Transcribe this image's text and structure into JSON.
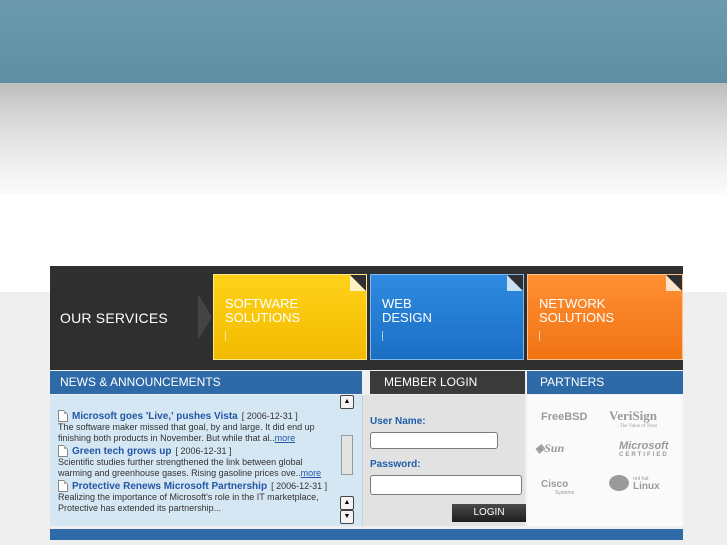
{
  "services": {
    "title": "OUR SERVICES",
    "tiles": [
      {
        "line1": "SOFTWARE",
        "line2": "SOLUTIONS",
        "color": "#f5c400"
      },
      {
        "line1": "WEB",
        "line2": "DESIGN",
        "color": "#2a7fd6"
      },
      {
        "line1": "NETWORK",
        "line2": "SOLUTIONS",
        "color": "#f98125"
      }
    ]
  },
  "news": {
    "header": "NEWS & ANNOUNCEMENTS",
    "items": [
      {
        "title": "Microsoft goes 'Live,' pushes Vista",
        "date": "[ 2006-12-31 ]",
        "summary": "The software maker missed that goal, by and large. It did end up finishing both products in November. But while that al..",
        "more": "more"
      },
      {
        "title": "Green tech grows up",
        "date": "[ 2006-12-31 ]",
        "summary": "Scientific studies further strengthened the link between global warming and greenhouse gases. Rising gasoline prices ove..",
        "more": "more"
      },
      {
        "title": "Protective Renews Microsoft Partnership",
        "date": "[ 2006-12-31 ]",
        "summary": "Realizing the importance of Microsoft's role in the IT marketplace, Protective has extended its partnership...",
        "more": ""
      }
    ]
  },
  "login": {
    "header": "MEMBER LOGIN",
    "username_label": "User Name:",
    "username_value": "",
    "password_label": "Password:",
    "password_value": "",
    "button": "LOGIN"
  },
  "partners": {
    "header": "PARTNERS",
    "logos": [
      "FreeBSD",
      "VeriSign",
      "Sun",
      "Microsoft",
      "Cisco",
      "Linux"
    ],
    "verisign_tagline": "The Value of Trust",
    "microsoft_sub": "CERTIFIED",
    "cisco_sub": "Systems",
    "linux_sub": "red hat"
  },
  "colors": {
    "topbar": "#6395a9",
    "panel_blue": "#2f6aa8",
    "news_bg": "#d5e7f3"
  }
}
